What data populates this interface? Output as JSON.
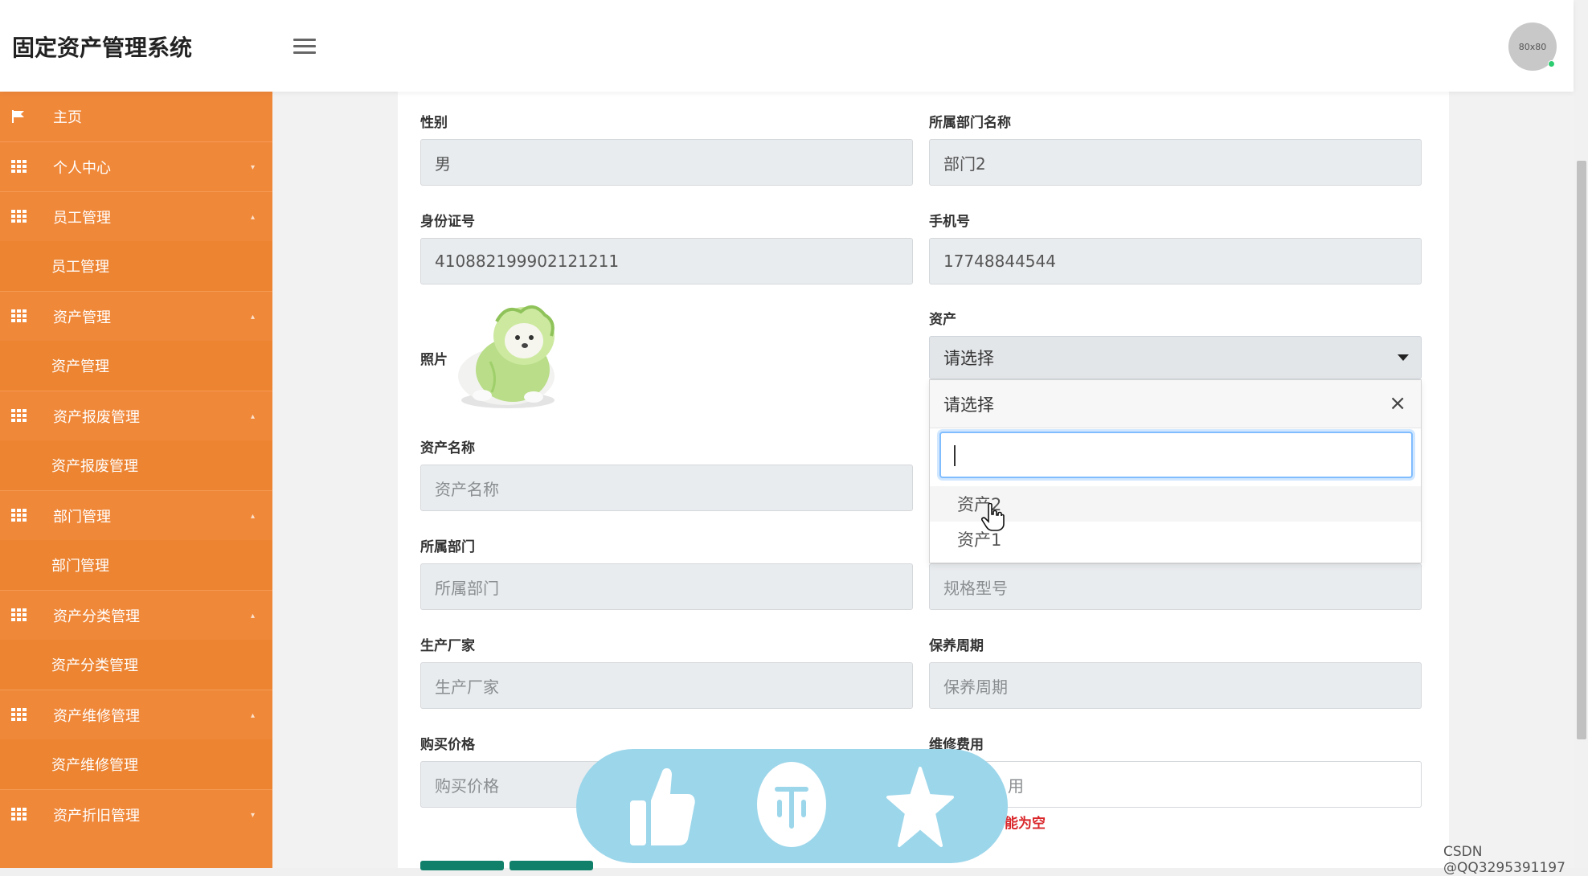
{
  "header": {
    "app_title": "固定资产管理系统",
    "avatar_text": "80x80"
  },
  "sidebar": {
    "items": [
      {
        "label": "主页",
        "type": "group",
        "icon": "flag-icon"
      },
      {
        "label": "个人中心",
        "type": "group",
        "icon": "grid-icon",
        "caret": "▾"
      },
      {
        "label": "员工管理",
        "type": "group",
        "icon": "grid-icon",
        "caret": "▴"
      },
      {
        "label": "员工管理",
        "type": "sub"
      },
      {
        "label": "资产管理",
        "type": "group",
        "icon": "grid-icon",
        "caret": "▴"
      },
      {
        "label": "资产管理",
        "type": "sub"
      },
      {
        "label": "资产报废管理",
        "type": "group",
        "icon": "grid-icon",
        "caret": "▴"
      },
      {
        "label": "资产报废管理",
        "type": "sub"
      },
      {
        "label": "部门管理",
        "type": "group",
        "icon": "grid-icon",
        "caret": "▴"
      },
      {
        "label": "部门管理",
        "type": "sub"
      },
      {
        "label": "资产分类管理",
        "type": "group",
        "icon": "grid-icon",
        "caret": "▴"
      },
      {
        "label": "资产分类管理",
        "type": "sub"
      },
      {
        "label": "资产维修管理",
        "type": "group",
        "icon": "grid-icon",
        "caret": "▴"
      },
      {
        "label": "资产维修管理",
        "type": "sub"
      },
      {
        "label": "资产折旧管理",
        "type": "group",
        "icon": "grid-icon",
        "caret": "▾"
      }
    ]
  },
  "form": {
    "gender": {
      "label": "性别",
      "value": "男"
    },
    "dept_name": {
      "label": "所属部门名称",
      "value": "部门2"
    },
    "id_number": {
      "label": "身份证号",
      "value": "410882199902121211"
    },
    "phone": {
      "label": "手机号",
      "value": "17748844544"
    },
    "photo": {
      "label": "照片"
    },
    "asset": {
      "label": "资产",
      "selected": "请选择",
      "dropdown_header": "请选择",
      "close_symbol": "×",
      "search_value": "",
      "options": [
        "资产2",
        "资产1"
      ]
    },
    "asset_name": {
      "label": "资产名称",
      "placeholder": "资产名称"
    },
    "department": {
      "label": "所属部门",
      "placeholder": "所属部门"
    },
    "spec_model": {
      "placeholder": "规格型号"
    },
    "manufacturer": {
      "label": "生产厂家",
      "placeholder": "生产厂家"
    },
    "maintenance_cycle": {
      "label": "保养周期",
      "placeholder": "保养周期"
    },
    "purchase_price": {
      "label": "购买价格",
      "placeholder": "购买价格"
    },
    "repair_cost": {
      "label": "维修费用",
      "placeholder": "用"
    },
    "error_message": "能为空"
  },
  "overlay": {
    "icons": [
      "thumbs-up-icon",
      "coin-icon",
      "star-icon"
    ],
    "color": "#9cd6ea"
  },
  "watermark": "CSDN @QQ3295391197",
  "colors": {
    "sidebar": "#f0883a",
    "button": "#11806a",
    "error": "#d9262a"
  }
}
